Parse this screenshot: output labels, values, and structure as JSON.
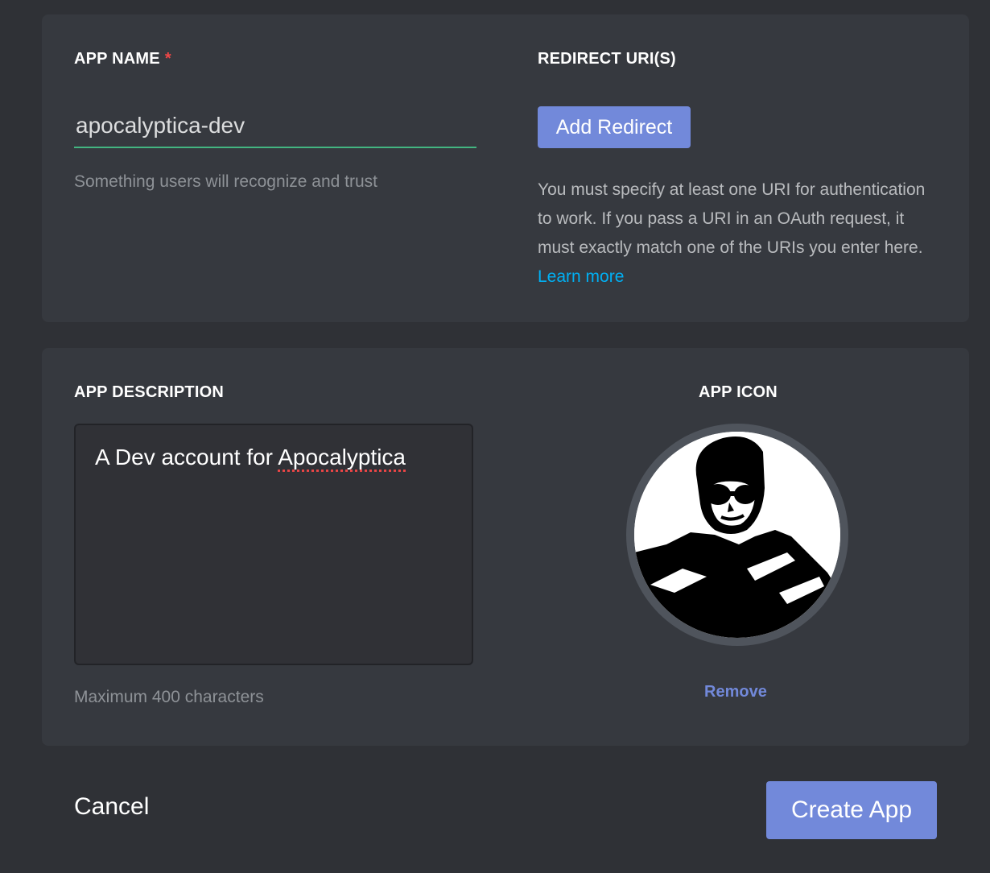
{
  "app_name": {
    "label": "APP NAME",
    "required_mark": "*",
    "value": "apocalyptica-dev",
    "hint": "Something users will recognize and trust"
  },
  "redirect": {
    "label": "REDIRECT URI(S)",
    "button_label": "Add Redirect",
    "help_text": "You must specify at least one URI for authentication to work. If you pass a URI in an OAuth request, it must exactly match one of the URIs you enter here.",
    "learn_more_label": "Learn more"
  },
  "description": {
    "label": "APP DESCRIPTION",
    "text_prefix": "A Dev account for ",
    "text_misspelled": "Apocalyptica",
    "hint": "Maximum 400 characters"
  },
  "app_icon": {
    "label": "APP ICON",
    "icon": "app-avatar-image",
    "remove_label": "Remove"
  },
  "footer": {
    "cancel_label": "Cancel",
    "create_label": "Create App"
  },
  "colors": {
    "page_background": "#2f3136",
    "card_background": "#36393f",
    "accent": "#7289da",
    "input_underline": "#43b581",
    "required": "#f04747",
    "link": "#00b0f4"
  }
}
